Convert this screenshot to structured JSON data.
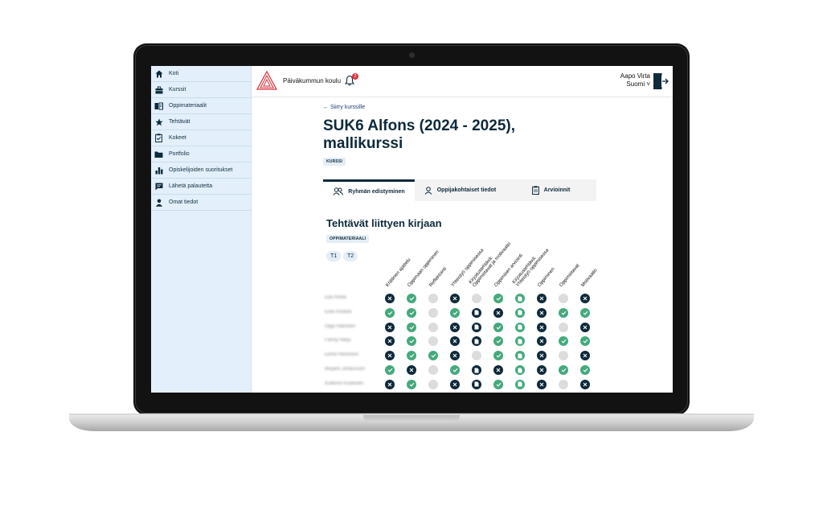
{
  "sidebar": {
    "items": [
      {
        "label": "Koti",
        "icon": "home-icon"
      },
      {
        "label": "Kurssit",
        "icon": "briefcase-icon"
      },
      {
        "label": "Oppimateriaalit",
        "icon": "book-icon"
      },
      {
        "label": "Tehtävät",
        "icon": "star-icon"
      },
      {
        "label": "Kokeet",
        "icon": "clipboard-icon"
      },
      {
        "label": "Portfolio",
        "icon": "folder-icon"
      },
      {
        "label": "Opiskelijoiden suoritukset",
        "icon": "bar-chart-icon"
      },
      {
        "label": "Lähetä palautetta",
        "icon": "feedback-icon"
      },
      {
        "label": "Omat tiedot",
        "icon": "person-icon"
      }
    ]
  },
  "header": {
    "school": "Päiväkummun koulu",
    "notification_count": "2",
    "user_name": "Aapo Virta",
    "language": "Suomi ˅"
  },
  "main": {
    "back_link": "← Siirry kurssille",
    "title": "SUK6 Alfons (2024 - 2025), mallikurssi",
    "course_tag": "KURSSI",
    "tabs": [
      {
        "label": "Ryhmän edistyminen",
        "icon": "group-icon"
      },
      {
        "label": "Oppijakohtaiset tiedot",
        "icon": "person-icon"
      },
      {
        "label": "Arvioinnit",
        "icon": "clipboard-icon"
      }
    ],
    "section_title": "Tehtävät liittyen kirjaan",
    "material_tag": "OPPIMATERIAALI",
    "chips": [
      "T1",
      "T2"
    ]
  },
  "grid": {
    "columns": [
      "Kriittinen ajattelu",
      "Oppimaan oppiminen",
      "Reflektointi",
      "Yhteistyö oppimisessa",
      "Kirjoitustehtävä:\nOppimistavat ja motivaatio",
      "Oppimisen arviointi",
      "Kirjoitustehtävä:\nYhteistyö oppimisessa",
      "Oppiminen",
      "Oppimistavat",
      "Motivaatio"
    ],
    "rows": [
      {
        "name": "Eila Ahola",
        "cells": [
          "x",
          "c",
          "e",
          "x",
          "e",
          "c",
          "d",
          "x",
          "e",
          "x"
        ]
      },
      {
        "name": "Elias Kiiskila",
        "cells": [
          "c",
          "c",
          "e",
          "c",
          "d",
          "x",
          "d",
          "x",
          "c",
          "c"
        ]
      },
      {
        "name": "Olga Hakonen",
        "cells": [
          "x",
          "c",
          "e",
          "x",
          "d",
          "c",
          "d",
          "x",
          "e",
          "x"
        ]
      },
      {
        "name": "Fanny Harju",
        "cells": [
          "x",
          "c",
          "e",
          "x",
          "d",
          "c",
          "d",
          "x",
          "c",
          "c"
        ]
      },
      {
        "name": "Eemil Heinonen",
        "cells": [
          "x",
          "c",
          "c",
          "x",
          "e",
          "c",
          "d",
          "x",
          "e",
          "x"
        ]
      },
      {
        "name": "Mirjami Johansson",
        "cells": [
          "c",
          "x",
          "e",
          "c",
          "d",
          "x",
          "d",
          "x",
          "c",
          "c"
        ]
      },
      {
        "name": "Kullervo Koskinen",
        "cells": [
          "x",
          "c",
          "e",
          "x",
          "d",
          "c",
          "d",
          "x",
          "e",
          "x"
        ]
      }
    ]
  }
}
